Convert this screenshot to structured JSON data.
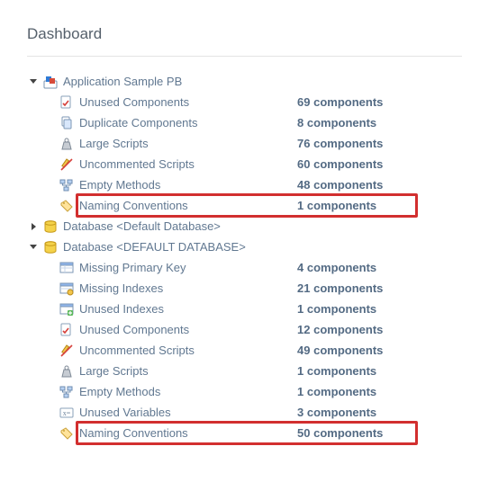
{
  "title": "Dashboard",
  "count_suffix": "components",
  "nodes": [
    {
      "id": "app-pb",
      "label": "Application Sample PB",
      "icon": "app-icon",
      "expanded": true,
      "children": [
        {
          "id": "unused-comp-1",
          "label": "Unused Components",
          "count": 69,
          "icon": "check-doc-icon",
          "highlight": false
        },
        {
          "id": "dup-comp",
          "label": "Duplicate Components",
          "count": 8,
          "icon": "copy-icon",
          "highlight": false
        },
        {
          "id": "large-scripts-1",
          "label": "Large Scripts",
          "count": 76,
          "icon": "weight-icon",
          "highlight": false
        },
        {
          "id": "uncom-scripts-1",
          "label": "Uncommented Scripts",
          "count": 60,
          "icon": "pencil-slash-icon",
          "highlight": false
        },
        {
          "id": "empty-meth-1",
          "label": "Empty Methods",
          "count": 48,
          "icon": "tree-node-icon",
          "highlight": false
        },
        {
          "id": "naming-conv-1",
          "label": "Naming Conventions",
          "count": 1,
          "icon": "tag-icon",
          "highlight": true
        }
      ]
    },
    {
      "id": "db-default-lower",
      "label": "Database <Default Database>",
      "icon": "db-icon",
      "expanded": false,
      "children": []
    },
    {
      "id": "db-default-upper",
      "label": "Database <DEFAULT DATABASE>",
      "icon": "db-icon",
      "expanded": true,
      "children": [
        {
          "id": "miss-pk",
          "label": "Missing Primary Key",
          "count": 4,
          "icon": "table-key-icon",
          "highlight": false
        },
        {
          "id": "miss-idx",
          "label": "Missing Indexes",
          "count": 21,
          "icon": "table-warn-icon",
          "highlight": false
        },
        {
          "id": "unused-idx",
          "label": "Unused Indexes",
          "count": 1,
          "icon": "table-plus-icon",
          "highlight": false
        },
        {
          "id": "unused-comp-2",
          "label": "Unused Components",
          "count": 12,
          "icon": "check-doc-icon",
          "highlight": false
        },
        {
          "id": "uncom-scripts-2",
          "label": "Uncommented Scripts",
          "count": 49,
          "icon": "pencil-slash-icon",
          "highlight": false
        },
        {
          "id": "large-scripts-2",
          "label": "Large Scripts",
          "count": 1,
          "icon": "weight-icon",
          "highlight": false
        },
        {
          "id": "empty-meth-2",
          "label": "Empty Methods",
          "count": 1,
          "icon": "tree-node-icon",
          "highlight": false
        },
        {
          "id": "unused-vars",
          "label": "Unused Variables",
          "count": 3,
          "icon": "var-icon",
          "highlight": false
        },
        {
          "id": "naming-conv-2",
          "label": "Naming Conventions",
          "count": 50,
          "icon": "tag-icon",
          "highlight": true
        }
      ]
    }
  ]
}
